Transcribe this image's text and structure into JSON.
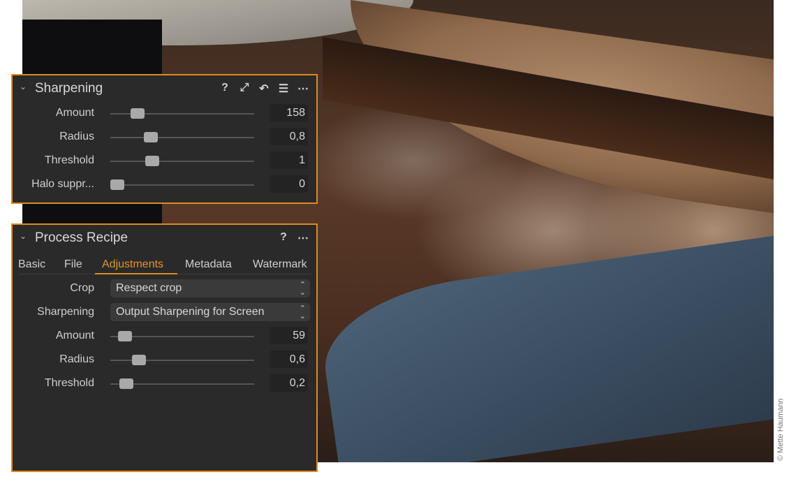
{
  "photo": {
    "description": "sourdough bread on linen cloth",
    "credit": "© Mette Haumann"
  },
  "colors": {
    "accent": "#e08a1e",
    "panel_bg": "#2a2a2a"
  },
  "sharpening_panel": {
    "title": "Sharpening",
    "header_icons": [
      "help-icon",
      "expand-icon",
      "reset-icon",
      "list-icon",
      "more-icon"
    ],
    "header_glyphs": {
      "help": "?",
      "expand": "⤢",
      "reset": "↶",
      "list": "☰",
      "more": "⋯"
    },
    "sliders": [
      {
        "label": "Amount",
        "value": "158",
        "position": 0.19
      },
      {
        "label": "Radius",
        "value": "0,8",
        "position": 0.28
      },
      {
        "label": "Threshold",
        "value": "1",
        "position": 0.29
      },
      {
        "label": "Halo suppr...",
        "value": "0",
        "position": 0.05
      }
    ]
  },
  "recipe_panel": {
    "title": "Process Recipe",
    "header_glyphs": {
      "help": "?",
      "more": "⋯"
    },
    "tabs": [
      "Basic",
      "File",
      "Adjustments",
      "Metadata",
      "Watermark"
    ],
    "active_tab": "Adjustments",
    "crop": {
      "label": "Crop",
      "value": "Respect crop"
    },
    "sharpening": {
      "label": "Sharpening",
      "value": "Output Sharpening for Screen"
    },
    "sliders": [
      {
        "label": "Amount",
        "value": "59",
        "position": 0.1
      },
      {
        "label": "Radius",
        "value": "0,6",
        "position": 0.2
      },
      {
        "label": "Threshold",
        "value": "0,2",
        "position": 0.11
      }
    ]
  }
}
